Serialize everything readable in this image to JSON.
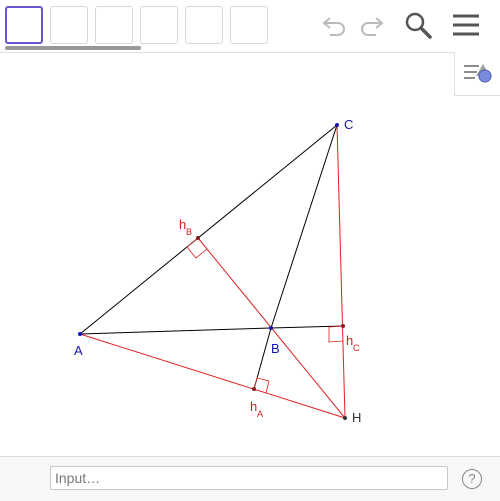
{
  "toolbar": {
    "tools": [
      "move-tool",
      "point-tool",
      "line-tool",
      "perpendicular-tool",
      "polygon-tool",
      "circle-tool"
    ],
    "undo_icon": "undo-icon",
    "redo_icon": "redo-icon",
    "search_icon": "search-icon",
    "menu_icon": "menu-icon"
  },
  "style_bar_icon": "style-bar-icon",
  "colors": {
    "black_segment": "#000000",
    "altitude_red": "#e02020",
    "label_blue": "#1414b4",
    "label_red": "#d42020",
    "active_tool": "#6557d2"
  },
  "geometry": {
    "points": {
      "A": "A",
      "B": "B",
      "C": "C",
      "H": "H"
    },
    "altitude_labels": {
      "hA_main": "h",
      "hA_sub": "A",
      "hB_main": "h",
      "hB_sub": "B",
      "hC_main": "h",
      "hC_sub": "C"
    }
  },
  "input_bar": {
    "placeholder": "Input…",
    "help_label": "?"
  }
}
